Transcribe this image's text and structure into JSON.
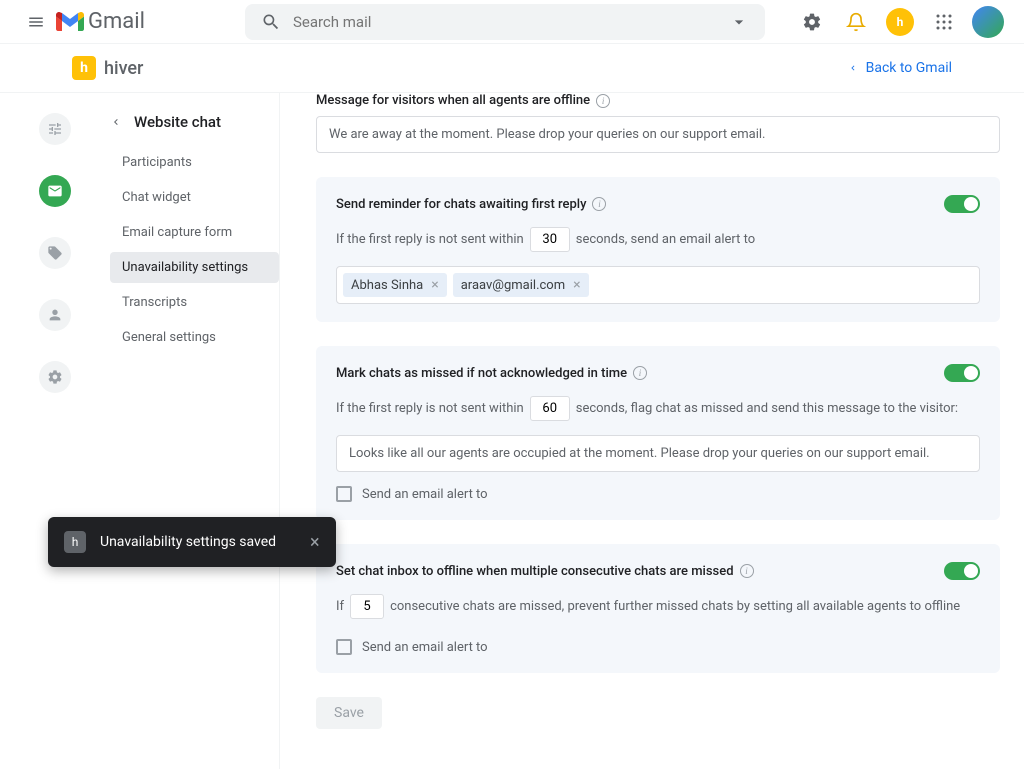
{
  "gmail_header": {
    "product": "Gmail",
    "search_placeholder": "Search mail"
  },
  "hiver_bar": {
    "brand": "hiver",
    "back_label": "Back to Gmail"
  },
  "sidebar": {
    "title": "Website chat",
    "items": [
      {
        "label": "Participants"
      },
      {
        "label": "Chat widget"
      },
      {
        "label": "Email capture form"
      },
      {
        "label": "Unavailability settings"
      },
      {
        "label": "Transcripts"
      },
      {
        "label": "General settings"
      }
    ],
    "active_index": 3
  },
  "content": {
    "offline_message": {
      "label": "Message for visitors when all agents are offline",
      "value": "We are away at the moment. Please drop your queries on our support email."
    },
    "reminder": {
      "title": "Send reminder for chats awaiting first reply",
      "enabled": true,
      "text_before": "If the first reply is not sent within",
      "seconds": "30",
      "text_after": "seconds, send an email alert to",
      "recipients": [
        "Abhas Sinha",
        "araav@gmail.com"
      ]
    },
    "missed": {
      "title": "Mark chats as missed if not acknowledged in time",
      "enabled": true,
      "text_before": "If the first reply is not sent within",
      "seconds": "60",
      "text_after": "seconds, flag chat as missed and send this message to the visitor:",
      "message": "Looks like all our agents are occupied at the moment. Please drop your queries on our support email.",
      "email_alert_label": "Send an email alert to"
    },
    "offline_auto": {
      "title": "Set chat inbox to offline when multiple consecutive chats are missed",
      "enabled": true,
      "text_before": "If",
      "count": "5",
      "text_after": "consecutive chats are missed, prevent further missed chats by setting all available agents to offline",
      "email_alert_label": "Send an email alert to"
    },
    "save_label": "Save"
  },
  "toast": {
    "message": "Unavailability settings saved"
  }
}
